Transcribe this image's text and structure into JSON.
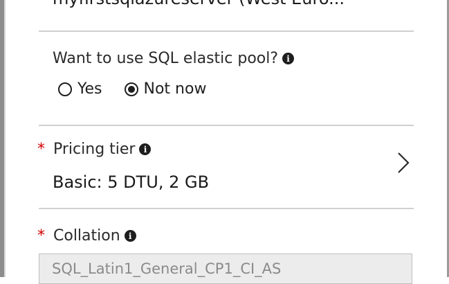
{
  "server": {
    "value": "myfirstsqlazureserver (West Euro..."
  },
  "elastic_pool": {
    "label": "Want to use SQL elastic pool?",
    "info_icon": "info-icon",
    "options": [
      {
        "label": "Yes",
        "selected": false
      },
      {
        "label": "Not now",
        "selected": true
      }
    ]
  },
  "pricing_tier": {
    "required_marker": "*",
    "label": "Pricing tier",
    "info_icon": "info-icon",
    "value": "Basic: 5 DTU, 2 GB",
    "chevron_icon": "chevron-right-icon"
  },
  "collation": {
    "required_marker": "*",
    "label": "Collation",
    "info_icon": "info-icon",
    "value": "SQL_Latin1_General_CP1_CI_AS"
  },
  "colors": {
    "required": "#d40000",
    "divider": "#d0d0d0",
    "disabled_input_bg": "#ececec",
    "disabled_text": "#8a8a8a"
  }
}
